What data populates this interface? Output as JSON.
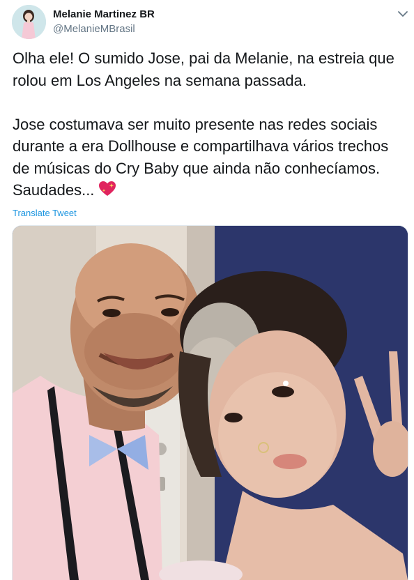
{
  "tweet": {
    "author_name": "Melanie Martinez BR",
    "author_handle": "@MelanieMBrasil",
    "lines": [
      "Olha ele! O sumido Jose, pai da Melanie, na estreia que",
      "rolou em Los Angeles na semana passada.",
      "",
      "Jose costumava ser muito presente nas redes sociais",
      "durante a era Dollhouse e compartilhava vários trechos",
      "de músicas do Cry Baby que ainda não conhecíamos.",
      "Saudades..."
    ],
    "emoji": "sparkling-heart",
    "translate_label": "Translate Tweet"
  },
  "colors": {
    "link": "#1b95e0",
    "handle": "#657786",
    "text": "#14171a"
  }
}
